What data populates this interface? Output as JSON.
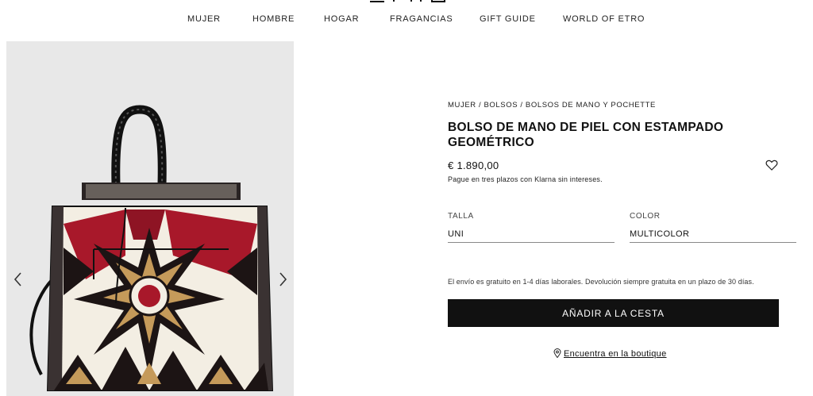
{
  "nav": {
    "items": [
      "MUJER",
      "HOMBRE",
      "HOGAR",
      "FRAGANCIAS",
      "GIFT GUIDE",
      "WORLD OF ETRO"
    ]
  },
  "product": {
    "breadcrumb": [
      "MUJER",
      "BOLSOS",
      "BOLSOS DE MANO Y POCHETTE"
    ],
    "breadcrumb_separator": "/",
    "title": "BOLSO DE MANO DE PIEL CON ESTAMPADO GEOMÉTRICO",
    "price": "€ 1.890,00",
    "klarna": "Pague en tres plazos con Klarna sin intereses.",
    "size_label": "TALLA",
    "size_value": "UNI",
    "color_label": "COLOR",
    "color_value": "MULTICOLOR",
    "shipping": "El envío es gratuito en 1-4 días laborales. Devolución siempre gratuita en un plazo de 30 días.",
    "cta": "AÑADIR A LA CESTA",
    "store_link": "Encuentra en la boutique"
  },
  "icons": {
    "wishlist": "heart-icon",
    "prev": "chevron-left-icon",
    "next": "chevron-right-icon",
    "store": "map-pin-icon"
  },
  "colors": {
    "accent": "#111111",
    "gallery_bg": "#e8e8e8",
    "print_red": "#a8182a",
    "print_cream": "#f3eee3"
  }
}
